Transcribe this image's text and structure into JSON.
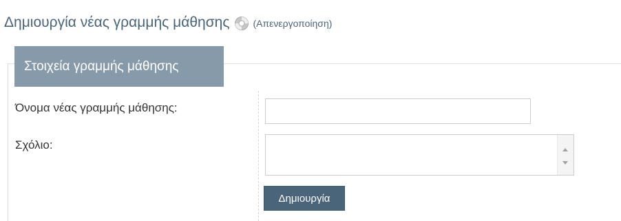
{
  "page": {
    "title": "Δημιουργία νέας γραμμής μάθησης",
    "help_icon": "lifebuoy-help-icon",
    "disable_link": "(Απενεργοποίηση)"
  },
  "form": {
    "legend": "Στοιχεία γραμμής μάθησης",
    "name_label": "Όνομα νέας γραμμής μάθησης:",
    "name_value": "",
    "comment_label": "Σχόλιο:",
    "comment_value": "",
    "submit_label": "Δημιουργία"
  },
  "colors": {
    "title_text": "#4a6479",
    "legend_background": "#869aa9",
    "button_background": "#4a6479",
    "border": "#dedede"
  }
}
